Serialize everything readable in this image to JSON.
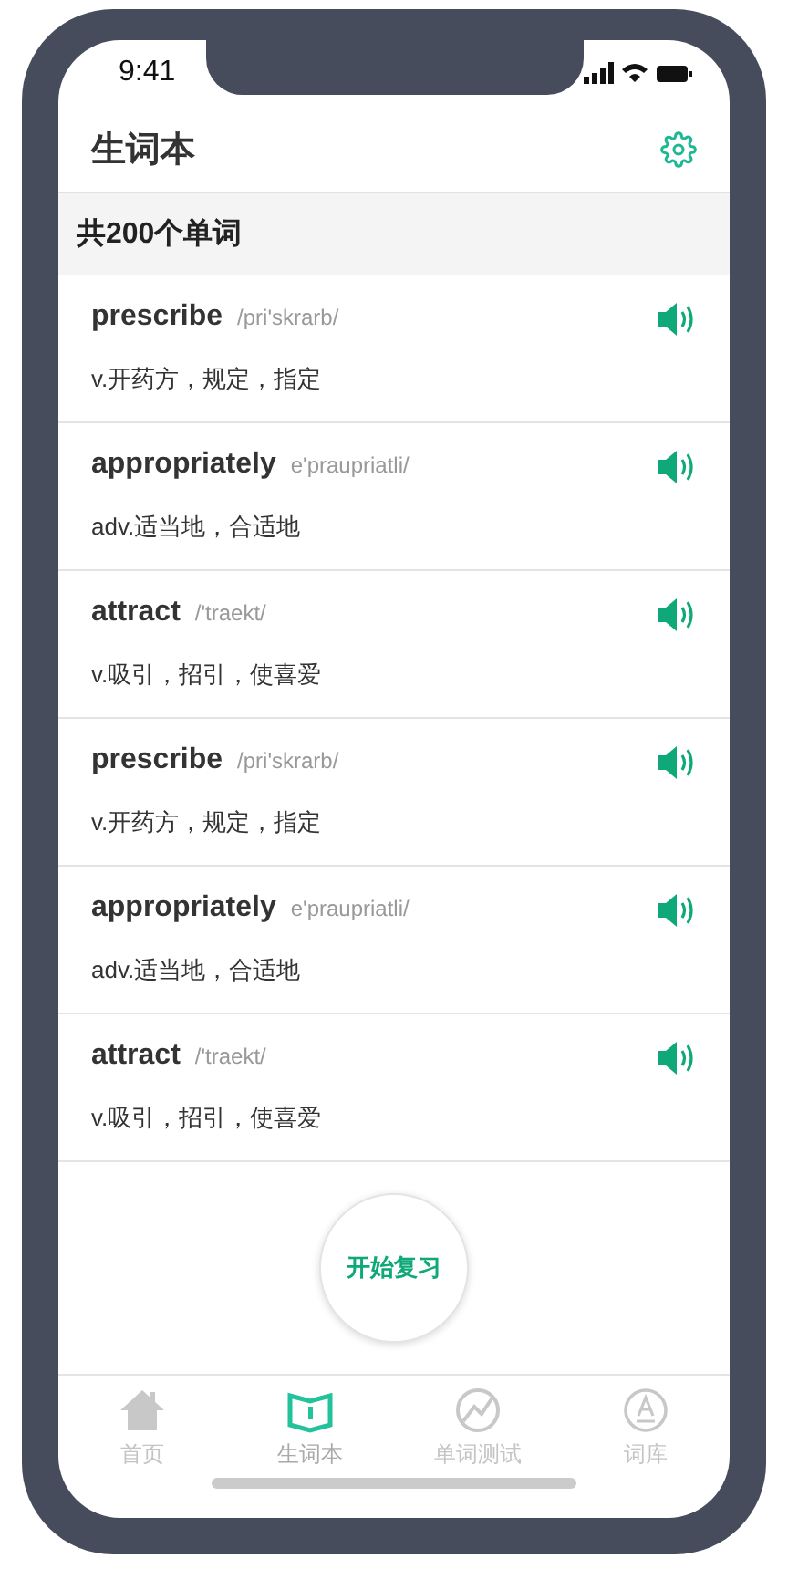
{
  "status_bar": {
    "time": "9:41"
  },
  "header": {
    "title": "生词本"
  },
  "summary": "共200个单词",
  "words": [
    {
      "word": "prescribe",
      "phonetic": "/pri'skrarb/",
      "meaning": "v.开药方，规定，指定"
    },
    {
      "word": "appropriately",
      "phonetic": "e'praupriatli/",
      "meaning": "adv.适当地，合适地"
    },
    {
      "word": "attract",
      "phonetic": "/'traekt/",
      "meaning": "v.吸引，招引，使喜爱"
    },
    {
      "word": "prescribe",
      "phonetic": "/pri'skrarb/",
      "meaning": "v.开药方，规定，指定"
    },
    {
      "word": "appropriately",
      "phonetic": "e'praupriatli/",
      "meaning": "adv.适当地，合适地"
    },
    {
      "word": "attract",
      "phonetic": "/'traekt/",
      "meaning": "v.吸引，招引，使喜爱"
    }
  ],
  "review_button": "开始复习",
  "tab_bar": [
    {
      "label": "首页",
      "selected": false
    },
    {
      "label": "生词本",
      "selected": true
    },
    {
      "label": "单词测试",
      "selected": false
    },
    {
      "label": "词库",
      "selected": false
    }
  ]
}
